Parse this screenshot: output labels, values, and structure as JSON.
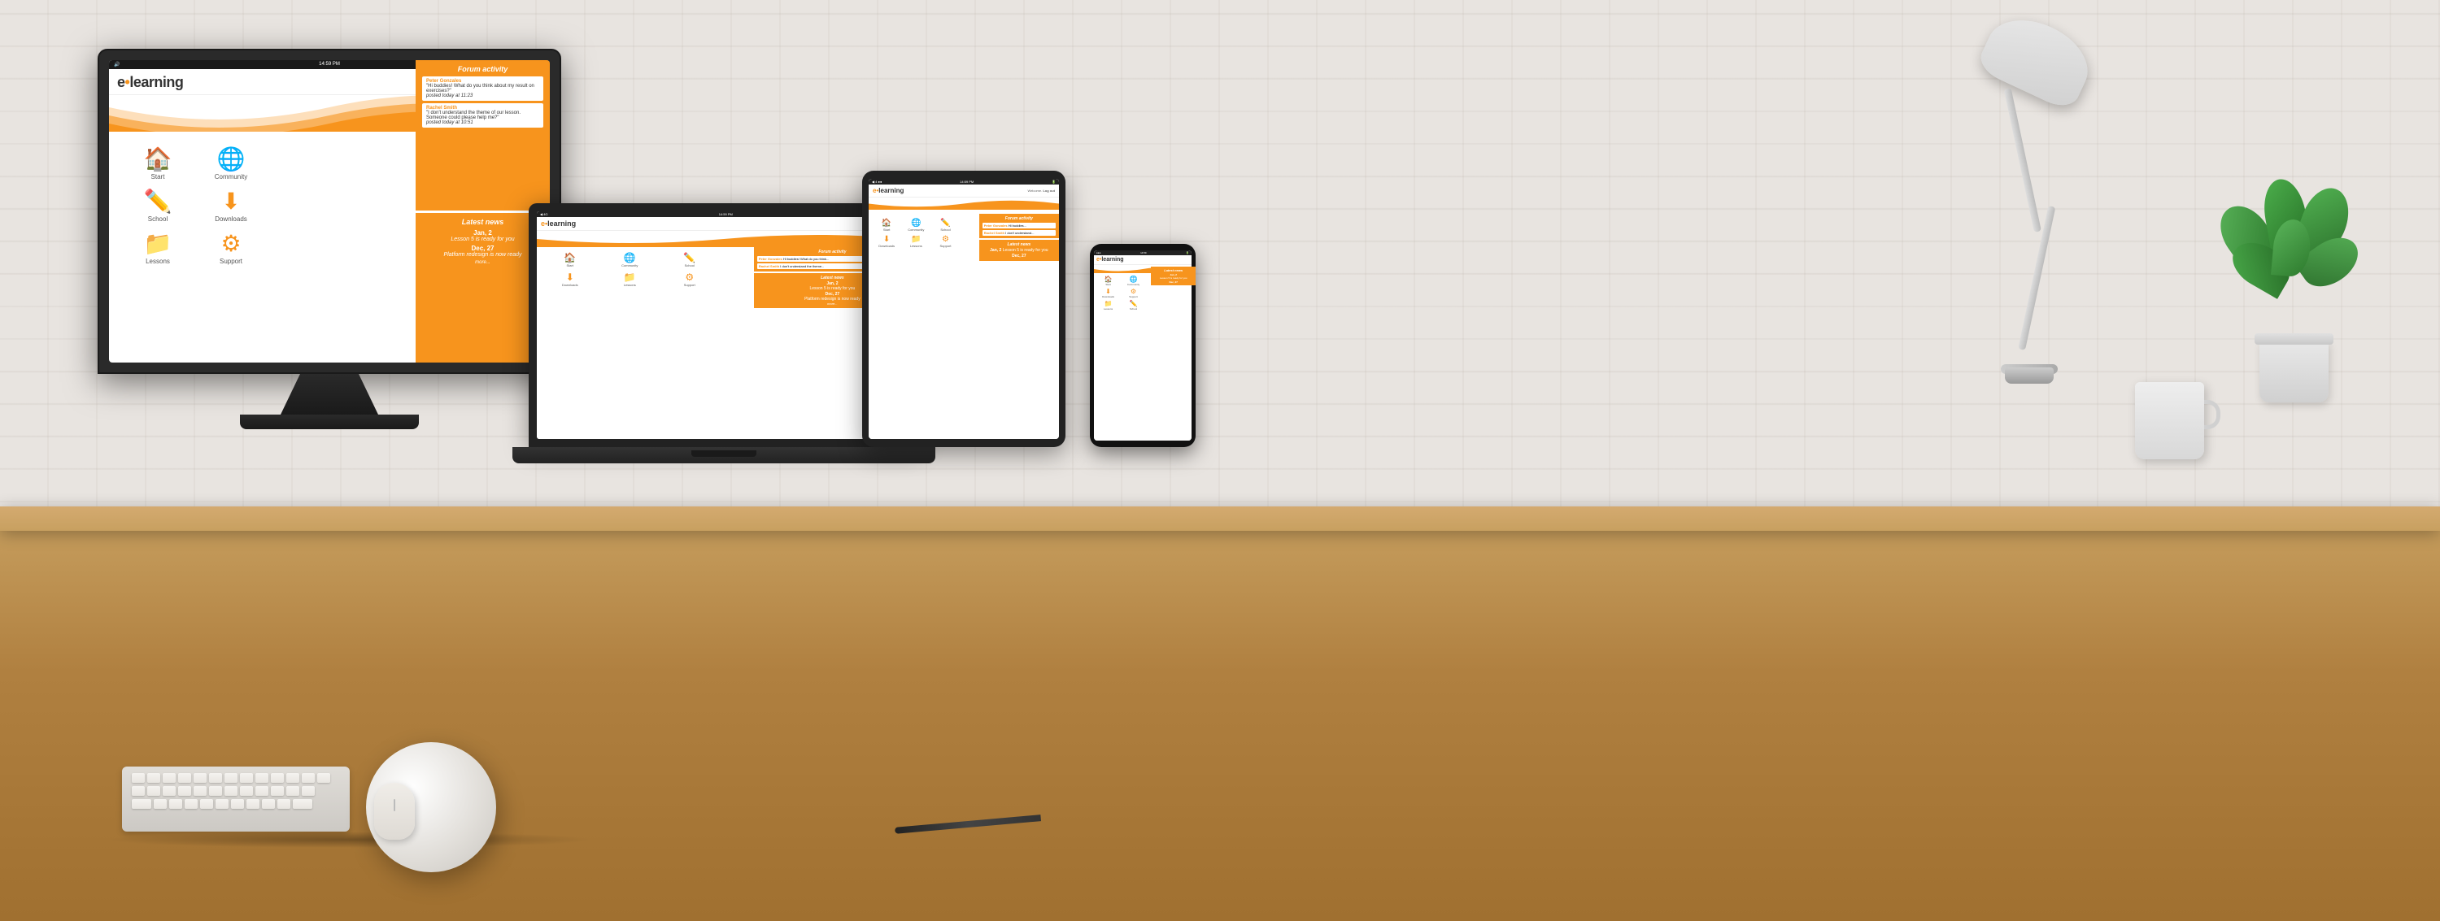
{
  "app": {
    "name": "e-learning",
    "logo_e": "e",
    "logo_dot": "•",
    "logo_learning": "learning",
    "welcome_text": "Welcome,",
    "logout_label": "Log out",
    "time": "14:59 PM",
    "battery": "🔋"
  },
  "nav": {
    "items": [
      {
        "id": "start",
        "label": "Start",
        "icon": "🏠"
      },
      {
        "id": "community",
        "label": "Community",
        "icon": "🌐"
      },
      {
        "id": "school",
        "label": "School",
        "icon": "✏️"
      },
      {
        "id": "downloads",
        "label": "Downloads",
        "icon": "⬇"
      },
      {
        "id": "lessons",
        "label": "Lessons",
        "icon": "📁"
      },
      {
        "id": "support",
        "label": "Support",
        "icon": "⚙"
      }
    ]
  },
  "forum": {
    "title": "Forum activity",
    "posts": [
      {
        "author": "Peter Gonzales",
        "text": "\"Hi buddies! What do you think about my result on exercises?\"",
        "time": "posted today at 11:23"
      },
      {
        "author": "Rachel Smith",
        "text": "\"I don't understand the theme of our lesson. Someone could please help me?\"",
        "time": "posted today at 10:51"
      }
    ]
  },
  "latest_news": {
    "title": "Latest news",
    "items": [
      {
        "date": "Jan, 2",
        "text": "Lesson 5 is ready for you"
      },
      {
        "date": "Dec, 27",
        "text": "Platform redesign is now ready"
      }
    ],
    "more_label": "more..."
  },
  "devices": {
    "desktop_time": "14:59 PM",
    "laptop_time": "14:59 PM",
    "tablet_time": "14:59 PM",
    "phone_time": "14:59"
  }
}
